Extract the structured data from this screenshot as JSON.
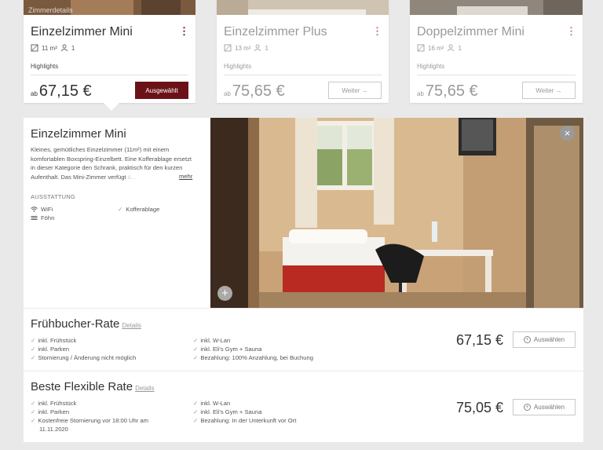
{
  "rooms": [
    {
      "thumb_label": "Zimmerdetails",
      "title": "Einzelzimmer Mini",
      "area": "11 m²",
      "guests": "1",
      "highlights": "Highlights",
      "price_prefix": "ab",
      "price": "67,15 €",
      "button": "Ausgewählt",
      "menu": "⋮"
    },
    {
      "title": "Einzelzimmer Plus",
      "area": "13 m²",
      "guests": "1",
      "highlights": "Highlights",
      "price_prefix": "ab",
      "price": "75,65 €",
      "button": "Weiter →",
      "menu": "⋮"
    },
    {
      "title": "Doppelzimmer Mini",
      "area": "16 m²",
      "guests": "1",
      "highlights": "Highlights",
      "price_prefix": "ab",
      "price": "75,65 €",
      "button": "Weiter →",
      "menu": "⋮"
    }
  ],
  "detail": {
    "title": "Einzelzimmer Mini",
    "description": "Kleines, gemütliches Einzelzimmer (11m²) mit einem komfortablen Boxspring-Einzelbett. Eine Kofferablage ersetzt in dieser Kategorie den Schrank, praktisch für den kurzen Aufenthalt. Das Mini-Zimmer verfügt",
    "description_fade": "ü…",
    "more": "mehr",
    "amenities_label": "AUSSTATTUNG",
    "amenities": [
      {
        "label": "WiFi",
        "icon": "wifi-icon"
      },
      {
        "label": "Kofferablage",
        "icon": "check-icon"
      },
      {
        "label": "Föhn",
        "icon": "hairdryer-icon"
      }
    ],
    "close": "×",
    "zoom": "+"
  },
  "rates": [
    {
      "title": "Frühbucher-Rate",
      "details": "Details",
      "features_left": [
        "inkl. Frühstück",
        "inkl. Parken",
        "Stornierung / Änderung nicht möglich"
      ],
      "features_right": [
        "inkl. W-Lan",
        "inkl. Eli's Gym + Sauna",
        "Bezahlung: 100% Anzahlung, bei Buchung"
      ],
      "price": "67,15 €",
      "button": "Auswählen"
    },
    {
      "title": "Beste Flexible Rate",
      "details": "Details",
      "features_left": [
        "inkl. Frühstück",
        "inkl. Parken",
        "Kostenfreie Stornierung vor 18:00 Uhr am 11.11.2020"
      ],
      "features_right": [
        "inkl. W-Lan",
        "inkl. Eli's Gym + Sauna",
        "Bezahlung: In der Unterkunft vor Ort"
      ],
      "price": "75,05 €",
      "button": "Auswählen"
    }
  ],
  "colors": {
    "accent": "#6b1218",
    "background": "#e9e9e9"
  }
}
